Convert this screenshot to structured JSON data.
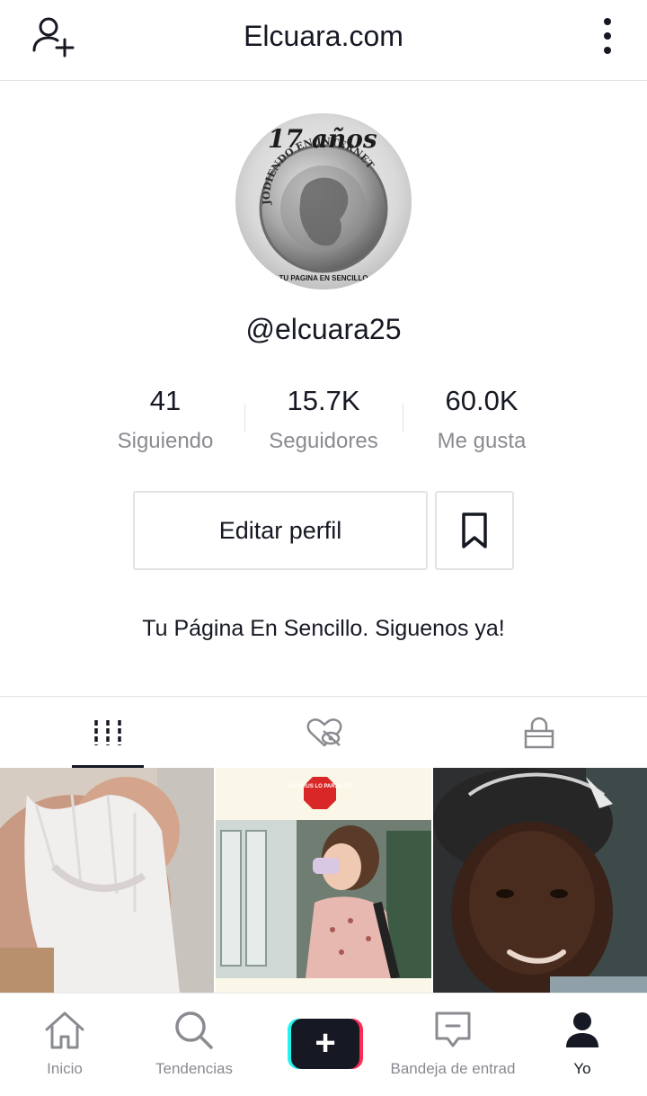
{
  "header": {
    "title": "Elcuara.com",
    "add_user_icon": "add-user-icon",
    "menu_icon": "vertical-dots-icon"
  },
  "profile": {
    "avatar_top_text": "17 años",
    "avatar_ring_text": "JODIENDO EN INTERNET",
    "avatar_bottom_text": "TU PAGINA EN SENCILLO",
    "handle": "@elcuara25",
    "bio": "Tu Página En Sencillo. Siguenos ya!"
  },
  "stats": {
    "following": {
      "value": "41",
      "label": "Siguiendo"
    },
    "followers": {
      "value": "15.7K",
      "label": "Seguidores"
    },
    "likes": {
      "value": "60.0K",
      "label": "Me gusta"
    }
  },
  "actions": {
    "edit_label": "Editar perfil",
    "bookmark_icon": "bookmark-icon"
  },
  "tabs": {
    "items": [
      {
        "icon": "videos-grid-icon",
        "active": true
      },
      {
        "icon": "liked-hidden-icon",
        "active": false
      },
      {
        "icon": "lock-icon",
        "active": false
      }
    ]
  },
  "videos": {
    "second_sign_text": "EL VIRUS LO PARAS TÚ"
  },
  "bottom_nav": {
    "home": "Inicio",
    "trends": "Tendencias",
    "inbox": "Bandeja de entrad",
    "me": "Yo"
  },
  "colors": {
    "text": "#161823",
    "muted": "#8a8b91",
    "border": "#e3e3e4",
    "accent_red": "#fe2c55",
    "accent_cyan": "#25f4ee"
  }
}
